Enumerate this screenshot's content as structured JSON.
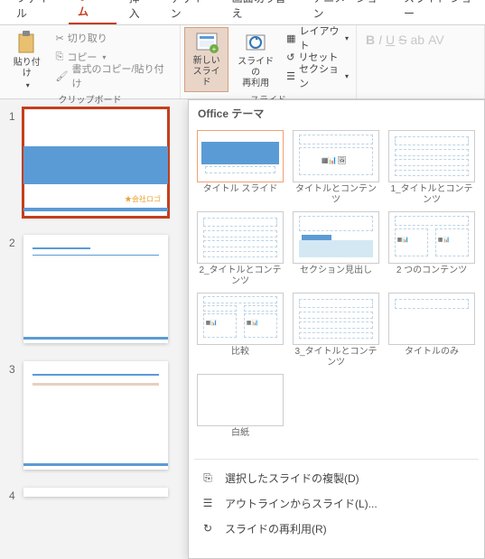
{
  "tabs": {
    "file": "ファイル",
    "home": "ホーム",
    "insert": "挿入",
    "design": "デザイン",
    "transition": "画面切り替え",
    "animation": "アニメーション",
    "slideshow": "スライド ショー"
  },
  "clipboard": {
    "paste": "貼り付け",
    "cut": "切り取り",
    "copy": "コピー",
    "format_painter": "書式のコピー/貼り付け",
    "group": "クリップボード"
  },
  "slides_group": {
    "new_slide": "新しい\nスライド",
    "reuse": "スライドの\n再利用",
    "layout": "レイアウト",
    "reset": "リセット",
    "section": "セクション",
    "group": "スライド"
  },
  "gallery": {
    "header": "Office テーマ",
    "items": [
      {
        "label": "タイトル スライド"
      },
      {
        "label": "タイトルとコンテンツ"
      },
      {
        "label": "1_タイトルとコンテンツ"
      },
      {
        "label": "2_タイトルとコンテンツ"
      },
      {
        "label": "セクション見出し"
      },
      {
        "label": "2 つのコンテンツ"
      },
      {
        "label": "比較"
      },
      {
        "label": "3_タイトルとコンテンツ"
      },
      {
        "label": "タイトルのみ"
      },
      {
        "label": "白紙"
      }
    ],
    "menu": {
      "duplicate": "選択したスライドの複製(D)",
      "outline": "アウトラインからスライド(L)...",
      "reuse": "スライドの再利用(R)"
    }
  },
  "slide_items": [
    "1",
    "2",
    "3",
    "4"
  ],
  "logo": "★会社ロゴ"
}
